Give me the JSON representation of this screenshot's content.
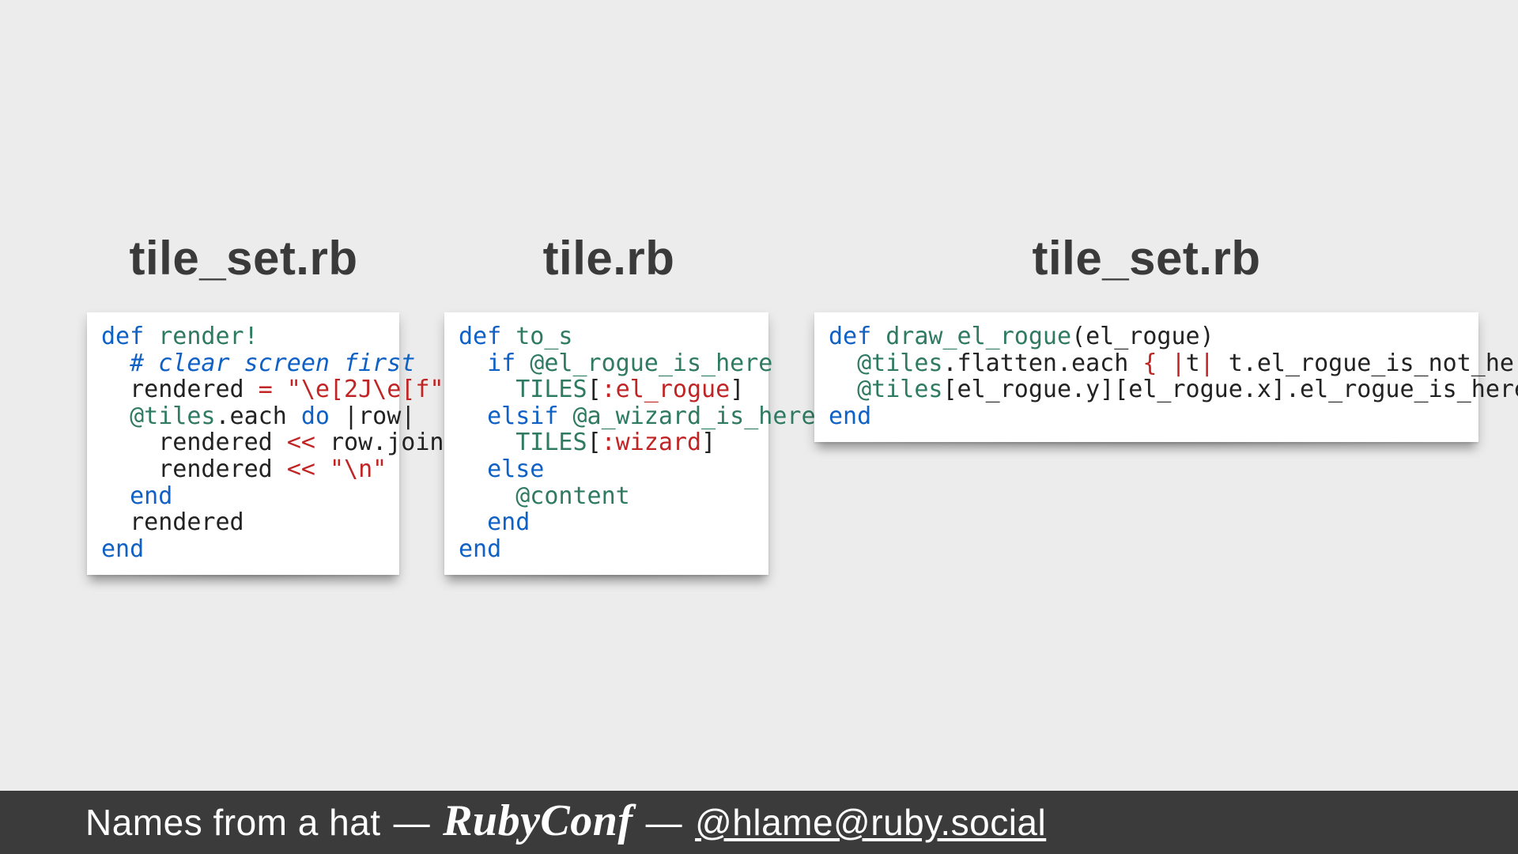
{
  "cards": [
    {
      "title": "tile_set.rb"
    },
    {
      "title": "tile.rb"
    },
    {
      "title": "tile_set.rb"
    }
  ],
  "code": {
    "c1": {
      "l1_kw": "def",
      "l1_fn": " render!",
      "l2_cmt": "  # clear screen first",
      "l3a": "  rendered ",
      "l3_op": "=",
      "l3_str": " \"\\e[2J\\e[f\"",
      "l4_ivar": "  @tiles",
      "l4b": ".each ",
      "l4_kw": "do",
      "l4c": " |row|",
      "l5a": "    rendered ",
      "l5_op": "<<",
      "l5b": " row.join",
      "l6a": "    rendered ",
      "l6_op": "<<",
      "l6_str": " \"\\n\"",
      "l7_kw": "  end",
      "l8": "  rendered",
      "l9_kw": "end"
    },
    "c2": {
      "l1_kw": "def",
      "l1_fn": " to_s",
      "l2_kw": "  if",
      "l2_ivar": " @el_rogue_is_here",
      "l3_const": "    TILES",
      "l3a": "[",
      "l3_sym": ":el_rogue",
      "l3b": "]",
      "l4_kw": "  elsif",
      "l4_ivar": " @a_wizard_is_here",
      "l5_const": "    TILES",
      "l5a": "[",
      "l5_sym": ":wizard",
      "l5b": "]",
      "l6_kw": "  else",
      "l7_ivar": "    @content",
      "l8_kw": "  end",
      "l9_kw": "end"
    },
    "c3": {
      "l1_kw": "def",
      "l1_fn": " draw_el_rogue",
      "l1b": "(el_rogue)",
      "l2_ivar": "  @tiles",
      "l2a": ".flatten.each ",
      "l2_cu1": "{ |",
      "l2b": "t",
      "l2_cu2": "|",
      "l2c": " t.el_rogue_is_not_here! ",
      "l2_cu3": "}",
      "l3_ivar": "  @tiles",
      "l3a": "[el_rogue.y][el_rogue.x].el_rogue_is_here!",
      "l4_kw": "end"
    }
  },
  "footer": {
    "talk": "Names from a hat",
    "dash": "—",
    "logo": "RubyConf",
    "handle": "@hlame@ruby.social"
  }
}
